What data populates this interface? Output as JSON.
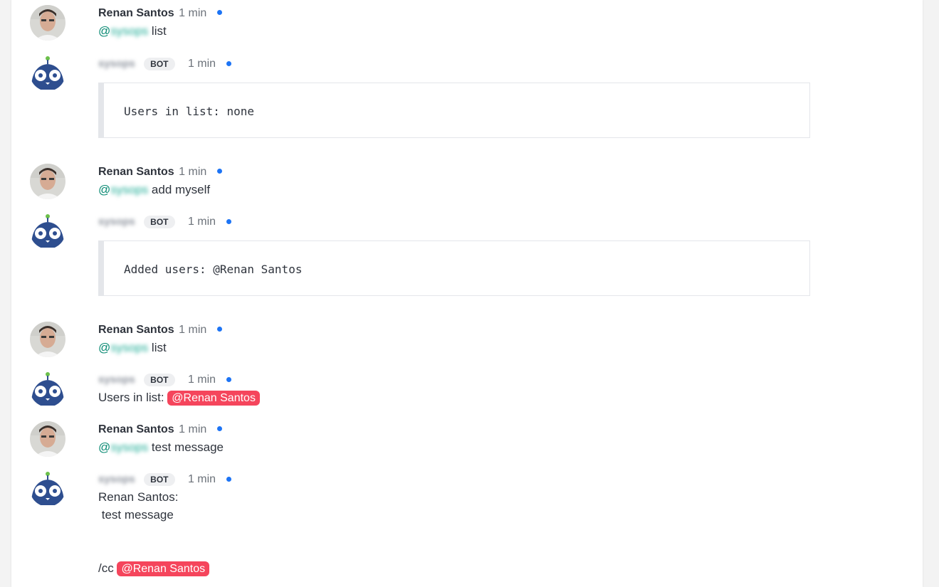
{
  "colors": {
    "accent": "#1d74f5",
    "mention_user": "#f5455c",
    "bot_mention": "#1aab94"
  },
  "users": {
    "human": "Renan Santos",
    "bot": "sysops",
    "bot_badge": "BOT"
  },
  "messages": [
    {
      "type": "human",
      "time": "1 min",
      "at": "@",
      "bot_mention": "sysops",
      "text": " list"
    },
    {
      "type": "bot",
      "time": "1 min",
      "code": "Users in list: none"
    },
    {
      "type": "human",
      "time": "1 min",
      "at": "@",
      "bot_mention": "sysops",
      "text": " add myself"
    },
    {
      "type": "bot",
      "time": "1 min",
      "code": "Added users: @Renan Santos"
    },
    {
      "type": "human",
      "time": "1 min",
      "at": "@",
      "bot_mention": "sysops",
      "text": " list"
    },
    {
      "type": "bot",
      "time": "1 min",
      "text_prefix": "Users in list: ",
      "mention": "@Renan Santos"
    },
    {
      "type": "human",
      "time": "1 min",
      "at": "@",
      "bot_mention": "sysops",
      "text": " test message"
    },
    {
      "type": "bot",
      "time": "1 min",
      "line1": "Renan Santos:",
      "line2": " test message",
      "cc_prefix": "/cc ",
      "mention": "@Renan Santos"
    }
  ]
}
